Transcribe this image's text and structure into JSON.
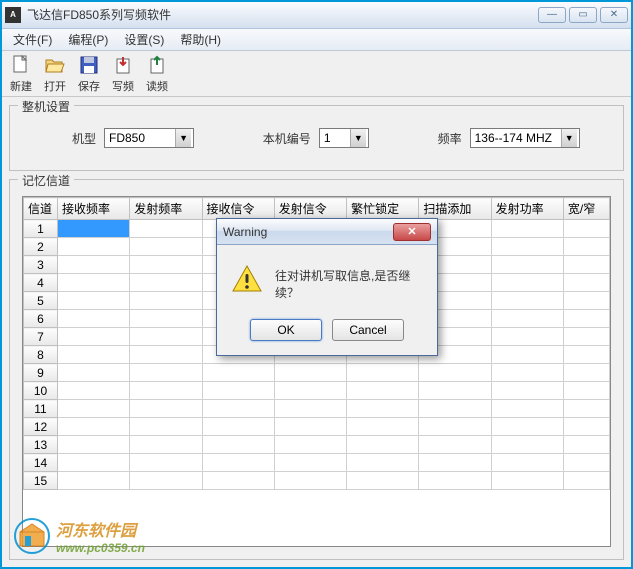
{
  "titlebar": {
    "icon_text": "A",
    "title": "飞达信FD850系列写频软件"
  },
  "menubar": {
    "items": [
      {
        "label": "文件(F)"
      },
      {
        "label": "编程(P)"
      },
      {
        "label": "设置(S)"
      },
      {
        "label": "帮助(H)"
      }
    ]
  },
  "toolbar": {
    "items": [
      {
        "name": "new",
        "label": "新建"
      },
      {
        "name": "open",
        "label": "打开"
      },
      {
        "name": "save",
        "label": "保存"
      },
      {
        "name": "write",
        "label": "写频"
      },
      {
        "name": "read",
        "label": "读频"
      }
    ]
  },
  "settings_group": {
    "title": "整机设置",
    "model_label": "机型",
    "model_value": "FD850",
    "unit_label": "本机编号",
    "unit_value": "1",
    "freq_label": "频率",
    "freq_value": "136--174 MHZ"
  },
  "channels_group": {
    "title": "记忆信道",
    "columns": [
      "信道",
      "接收频率",
      "发射频率",
      "接收信令",
      "发射信令",
      "繁忙锁定",
      "扫描添加",
      "发射功率",
      "宽/窄"
    ],
    "rows": [
      "1",
      "2",
      "3",
      "4",
      "5",
      "6",
      "7",
      "8",
      "9",
      "10",
      "11",
      "12",
      "13",
      "14",
      "15"
    ],
    "selected_row": 0,
    "selected_col": 0
  },
  "dialog": {
    "title": "Warning",
    "message": "往对讲机写取信息,是否继续？",
    "ok_label": "OK",
    "cancel_label": "Cancel"
  },
  "watermark": {
    "line1": "河东软件园",
    "line2": "www.pc0359.cn"
  }
}
